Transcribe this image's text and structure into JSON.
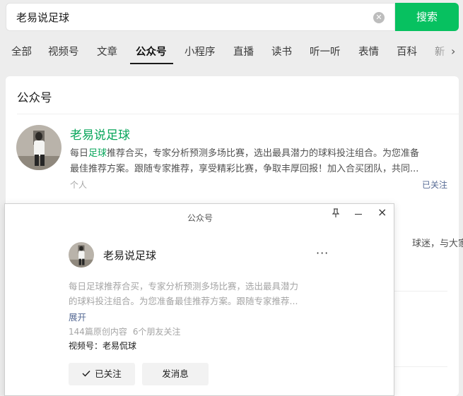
{
  "search": {
    "query": "老易说足球",
    "button_label": "搜索"
  },
  "tabs": [
    {
      "label": "全部"
    },
    {
      "label": "视频号"
    },
    {
      "label": "文章"
    },
    {
      "label": "公众号"
    },
    {
      "label": "小程序"
    },
    {
      "label": "直播"
    },
    {
      "label": "读书"
    },
    {
      "label": "听一听"
    },
    {
      "label": "表情"
    },
    {
      "label": "百科"
    },
    {
      "label": "新"
    }
  ],
  "active_tab": "公众号",
  "section": {
    "title": "公众号"
  },
  "result": {
    "name": "老易说足球",
    "desc_pre": "每日",
    "desc_hl": "足球",
    "desc_rest": "推荐合买，专家分析预测多场比赛，选出最具潜力的球料投注组合。为您准备",
    "desc_line2": "最佳推荐方案。跟随专家推荐，享受精彩比赛，争取丰厚回报！加入合买团队，共同...",
    "type": "个人",
    "follow_status": "已关注"
  },
  "background_snippet": "球迷，与大家",
  "popup": {
    "title": "公众号",
    "name": "老易说足球",
    "desc_line1": "每日足球推荐合买，专家分析预测多场比赛，选出最具潜力",
    "desc_line2": "的球料投注组合。为您准备最佳推荐方案。跟随专家推荐...",
    "expand_label": "展开",
    "original_count": "144篇原创内容",
    "friends_follow": "6个朋友关注",
    "channel": "视频号：老易侃球",
    "followed_label": "已关注",
    "message_label": "发消息"
  },
  "colors": {
    "accent": "#07c160",
    "link": "#576b95",
    "highlight": "#07a55a"
  }
}
